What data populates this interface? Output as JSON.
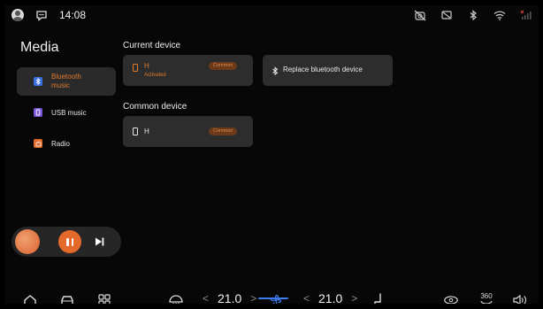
{
  "status_bar": {
    "time": "14:08",
    "left_icons": [
      "avatar-icon",
      "chat-bubble-icon"
    ],
    "right_icons": [
      "camera-off-icon",
      "screen-off-icon",
      "bluetooth-icon",
      "wifi-icon",
      "signal-icon"
    ]
  },
  "sidebar": {
    "title": "Media",
    "items": [
      {
        "label": "Bluetooth music",
        "icon": "bluetooth-icon",
        "active": true,
        "badge_color": "#3b6fe0"
      },
      {
        "label": "USB music",
        "icon": "usb-icon",
        "active": false,
        "badge_color": "#7a55d8"
      },
      {
        "label": "Radio",
        "icon": "radio-icon",
        "active": false,
        "badge_color": "#e06a2c"
      }
    ]
  },
  "current_device": {
    "section_title": "Current device",
    "name": "H",
    "status": "Activated",
    "badge": "Common"
  },
  "replace_device": {
    "label": "Replace bluetooth device",
    "icon": "bluetooth-icon"
  },
  "common_device": {
    "section_title": "Common device",
    "name": "H",
    "badge": "Common"
  },
  "player": {
    "album_icon": "album-art",
    "pause_icon": "pause-icon",
    "next_icon": "skip-next-icon"
  },
  "dock": {
    "left_temp": "21.0",
    "right_temp": "21.0",
    "temp_left_arrow": "<",
    "temp_right_arrow": ">",
    "view_360": "360",
    "icons": [
      "home-icon",
      "car-icon",
      "apps-grid-icon",
      "defrost-icon",
      "fan-icon",
      "seat-heat-icon",
      "camera-view-icon",
      "volume-icon"
    ]
  },
  "colors": {
    "accent": "#e36a2b",
    "card_bg": "#2d2d2d",
    "bg": "#070707",
    "indicator": "#3d7cf0"
  }
}
